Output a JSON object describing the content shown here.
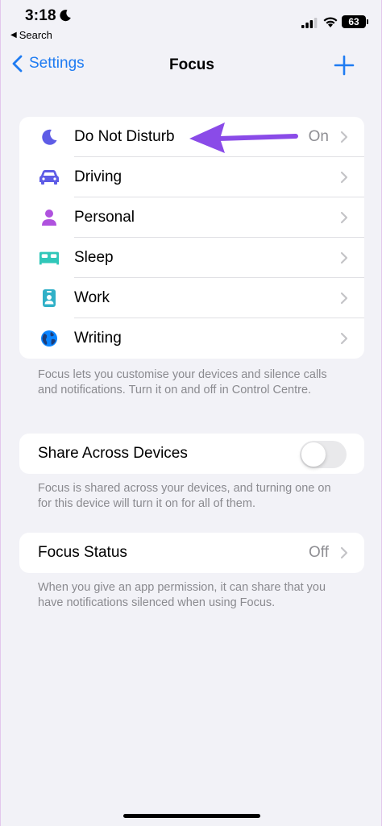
{
  "status_bar": {
    "time": "3:18",
    "back_app": "Search",
    "battery": "63"
  },
  "nav": {
    "back_label": "Settings",
    "title": "Focus"
  },
  "focus_modes": [
    {
      "label": "Do Not Disturb",
      "value": "On",
      "icon": "moon-icon",
      "color": "#5e5ce6"
    },
    {
      "label": "Driving",
      "value": "",
      "icon": "car-icon",
      "color": "#5e5ce6"
    },
    {
      "label": "Personal",
      "value": "",
      "icon": "person-icon",
      "color": "#af52de"
    },
    {
      "label": "Sleep",
      "value": "",
      "icon": "bed-icon",
      "color": "#30c7b9"
    },
    {
      "label": "Work",
      "value": "",
      "icon": "id-badge-icon",
      "color": "#30b0c7"
    },
    {
      "label": "Writing",
      "value": "",
      "icon": "globe-icon",
      "color": "#0a84ff"
    }
  ],
  "focus_footnote": "Focus lets you customise your devices and silence calls and notifications. Turn it on and off in Control Centre.",
  "share": {
    "label": "Share Across Devices",
    "enabled": false,
    "footnote": "Focus is shared across your devices, and turning one on for this device will turn it on for all of them."
  },
  "focus_status": {
    "label": "Focus Status",
    "value": "Off",
    "footnote": "When you give an app permission, it can share that you have notifications silenced when using Focus."
  },
  "colors": {
    "accent": "#1f7cf2",
    "annotation_arrow": "#8a4be8",
    "background": "#f2f2f7"
  }
}
